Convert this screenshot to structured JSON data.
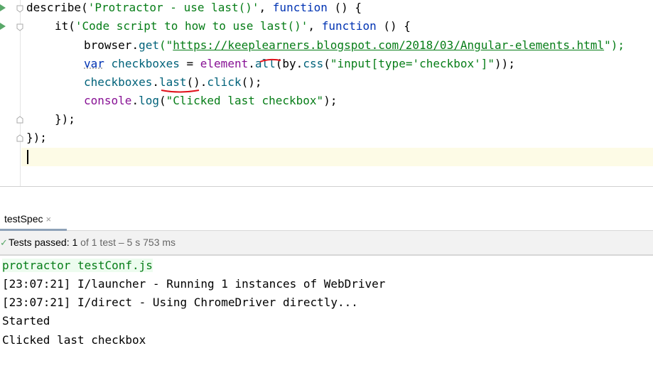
{
  "editor": {
    "lines": [
      {
        "t1": "describe(",
        "t2": "'Protractor - use last()'",
        "t3": ", ",
        "t4": "function",
        "t5": " () {"
      },
      {
        "t1": "it(",
        "t2": "'Code script to how to use last()'",
        "t3": ", ",
        "t4": "function",
        "t5": " () {"
      },
      {
        "t1": "browser",
        "t2": ".",
        "t3": "get",
        "t4": "(\"",
        "t5": "https://keeplearners.blogspot.com/2018/03/Angular-elements.html",
        "t6": "\");"
      },
      {
        "t1": "var",
        "t2": " ",
        "t3": "checkboxes",
        "t4": " = ",
        "t5": "element",
        "t6": ".",
        "t7": "all",
        "t8": "(",
        "t9": "by",
        "t10": ".",
        "t11": "css",
        "t12": "(",
        "t13": "\"input[type='checkbox']\"",
        "t14": "));"
      },
      {
        "t1": "checkboxes",
        "t2": ".",
        "t3": "last",
        "t4": "().",
        "t5": "click",
        "t6": "();"
      },
      {
        "t1": "console",
        "t2": ".",
        "t3": "log",
        "t4": "(",
        "t5": "\"Clicked last checkbox\"",
        "t6": ");"
      },
      {
        "t1": "});"
      },
      {
        "t1": "});"
      }
    ]
  },
  "panel": {
    "tab_label": "testSpec",
    "tab_close": "×",
    "status_check": "✓",
    "status_bold": "Tests passed: ",
    "status_count": "1",
    "status_detail": " of 1 test – 5 s 753 ms"
  },
  "console": {
    "command": "protractor testConf.js",
    "lines": [
      "[23:07:21] I/launcher - Running 1 instances of WebDriver",
      "[23:07:21] I/direct - Using ChromeDriver directly...",
      "Started",
      "Clicked last checkbox"
    ]
  },
  "colors": {
    "keyword": "#0033b3",
    "string": "#067d17",
    "property": "#871094",
    "function": "#00627a",
    "annotation_red": "#e0101a",
    "passed_green": "#59a869"
  }
}
